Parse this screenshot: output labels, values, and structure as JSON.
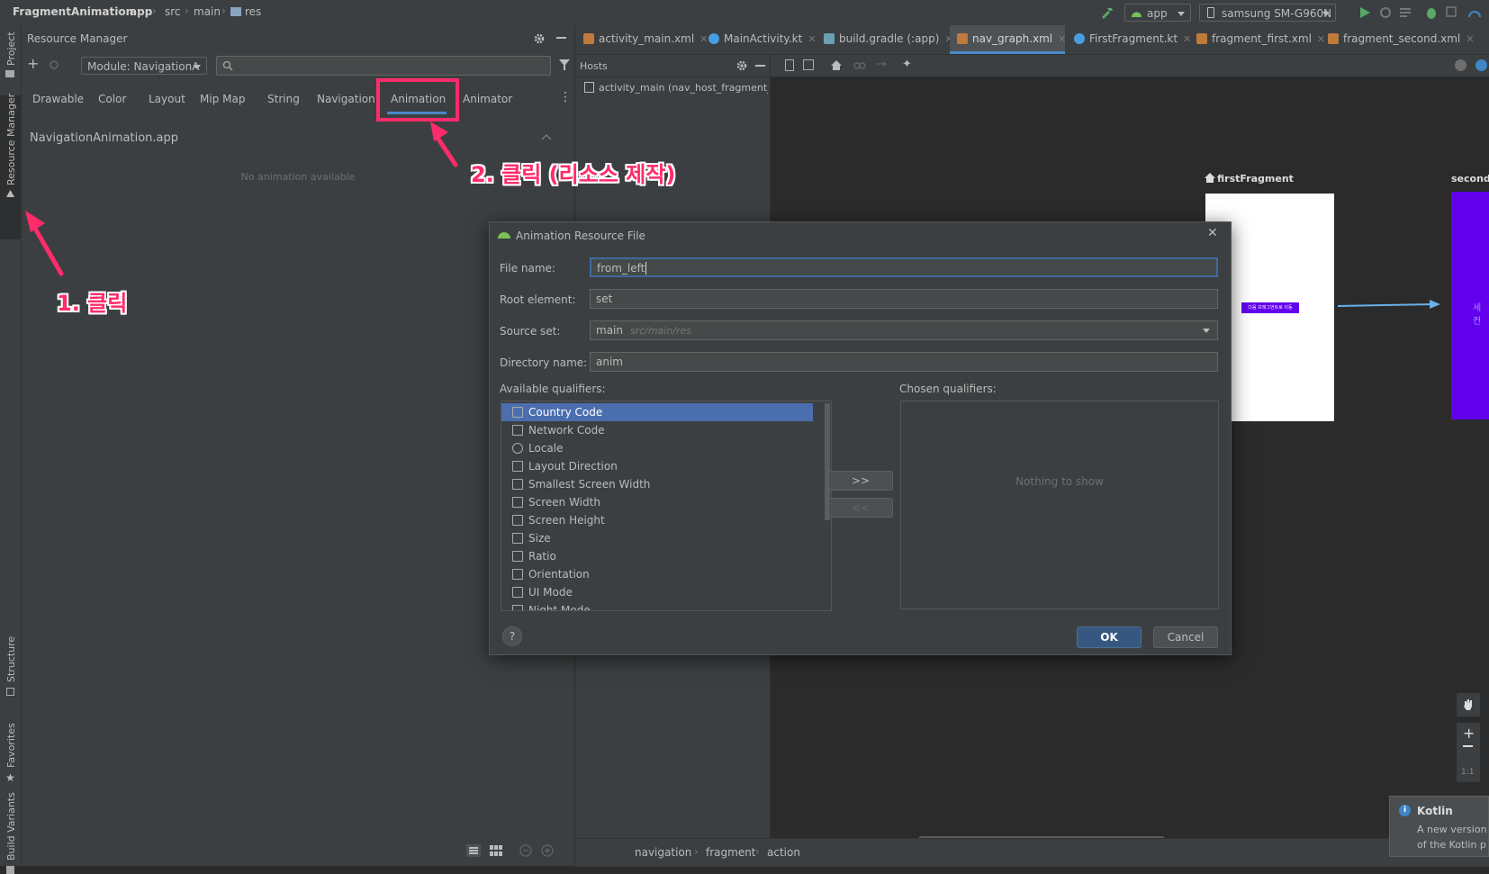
{
  "breadcrumb": [
    "FragmentAnimation",
    "app",
    "src",
    "main",
    "res"
  ],
  "toolbar": {
    "run_config": "app",
    "device": "samsung SM-G960N"
  },
  "left_strip": {
    "project": "Project",
    "resource_manager": "Resource Manager",
    "structure": "Structure",
    "favorites": "Favorites",
    "build_variants": "Build Variants"
  },
  "resource_manager": {
    "title": "Resource Manager",
    "module": "Module: NavigationA",
    "search_placeholder": "",
    "tabs": [
      "Drawable",
      "Color",
      "Layout",
      "Mip Map",
      "String",
      "Navigation",
      "Animation",
      "Animator"
    ],
    "active_tab": "Animation",
    "section_title": "NavigationAnimation.app",
    "empty_message": "No animation available"
  },
  "editor_tabs": [
    {
      "label": "activity_main.xml",
      "color": "#c07a3b"
    },
    {
      "label": "MainActivity.kt",
      "color": "#4a9ee0"
    },
    {
      "label": "build.gradle (:app)",
      "color": "#6aa0b0"
    },
    {
      "label": "nav_graph.xml",
      "color": "#c07a3b"
    },
    {
      "label": "FirstFragment.kt",
      "color": "#4a9ee0"
    },
    {
      "label": "fragment_first.xml",
      "color": "#c07a3b"
    },
    {
      "label": "fragment_second.xml",
      "color": "#c07a3b"
    }
  ],
  "active_editor_tab": "nav_graph.xml",
  "hosts": {
    "title": "Hosts",
    "item": "activity_main (nav_host_fragment_co"
  },
  "nav_graph": {
    "first_label": "firstFragment",
    "second_label": "secondF",
    "button_text": "다음 프래그먼트로 이동",
    "second_text": "세컨"
  },
  "dialog": {
    "title": "Animation Resource File",
    "file_name_label": "File name:",
    "file_name_value": "from_left",
    "root_element_label": "Root element:",
    "root_element_value": "set",
    "source_set_label": "Source set:",
    "source_set_value": "main",
    "source_set_hint": "src/main/res",
    "directory_label": "Directory name:",
    "directory_value": "anim",
    "available_label": "Available qualifiers:",
    "chosen_label": "Chosen qualifiers:",
    "qualifiers": [
      "Country Code",
      "Network Code",
      "Locale",
      "Layout Direction",
      "Smallest Screen Width",
      "Screen Width",
      "Screen Height",
      "Size",
      "Ratio",
      "Orientation",
      "UI Mode",
      "Night Mode"
    ],
    "selected_qualifier": "Country Code",
    "nothing_to_show": "Nothing to show",
    "add_button": ">>",
    "remove_button": "<<",
    "ok": "OK",
    "cancel": "Cancel",
    "help": "?"
  },
  "statusbar": {
    "crumbs": [
      "navigation",
      "fragment",
      "action"
    ]
  },
  "notification": {
    "title": "Kotlin",
    "line1": "A new version",
    "line2": "of the Kotlin p"
  },
  "annotations": {
    "step1": "1. 클릭",
    "step2": "2. 클릭 (리소스 제작)",
    "color": "#ff2b6a"
  },
  "zoom_ratio": "1:1"
}
